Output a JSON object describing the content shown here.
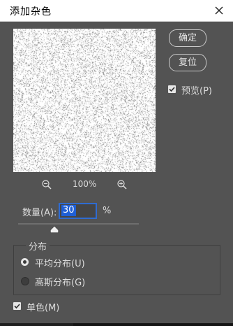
{
  "dialog": {
    "title": "添加杂色",
    "ok_label": "确定",
    "reset_label": "复位",
    "preview_label": "预览(P)",
    "preview_checked": true
  },
  "zoom": {
    "level": "100%"
  },
  "amount": {
    "label": "数量(A):",
    "value": "30",
    "unit": "%",
    "slider_fraction": 0.3
  },
  "distribution": {
    "title": "分布",
    "options": [
      {
        "label": "平均分布(U)",
        "selected": true
      },
      {
        "label": "高斯分布(G)",
        "selected": false
      }
    ]
  },
  "monochromatic": {
    "label": "单色(M)",
    "checked": true
  },
  "colors": {
    "panel": "#535353",
    "accent": "#1f5fd6"
  }
}
